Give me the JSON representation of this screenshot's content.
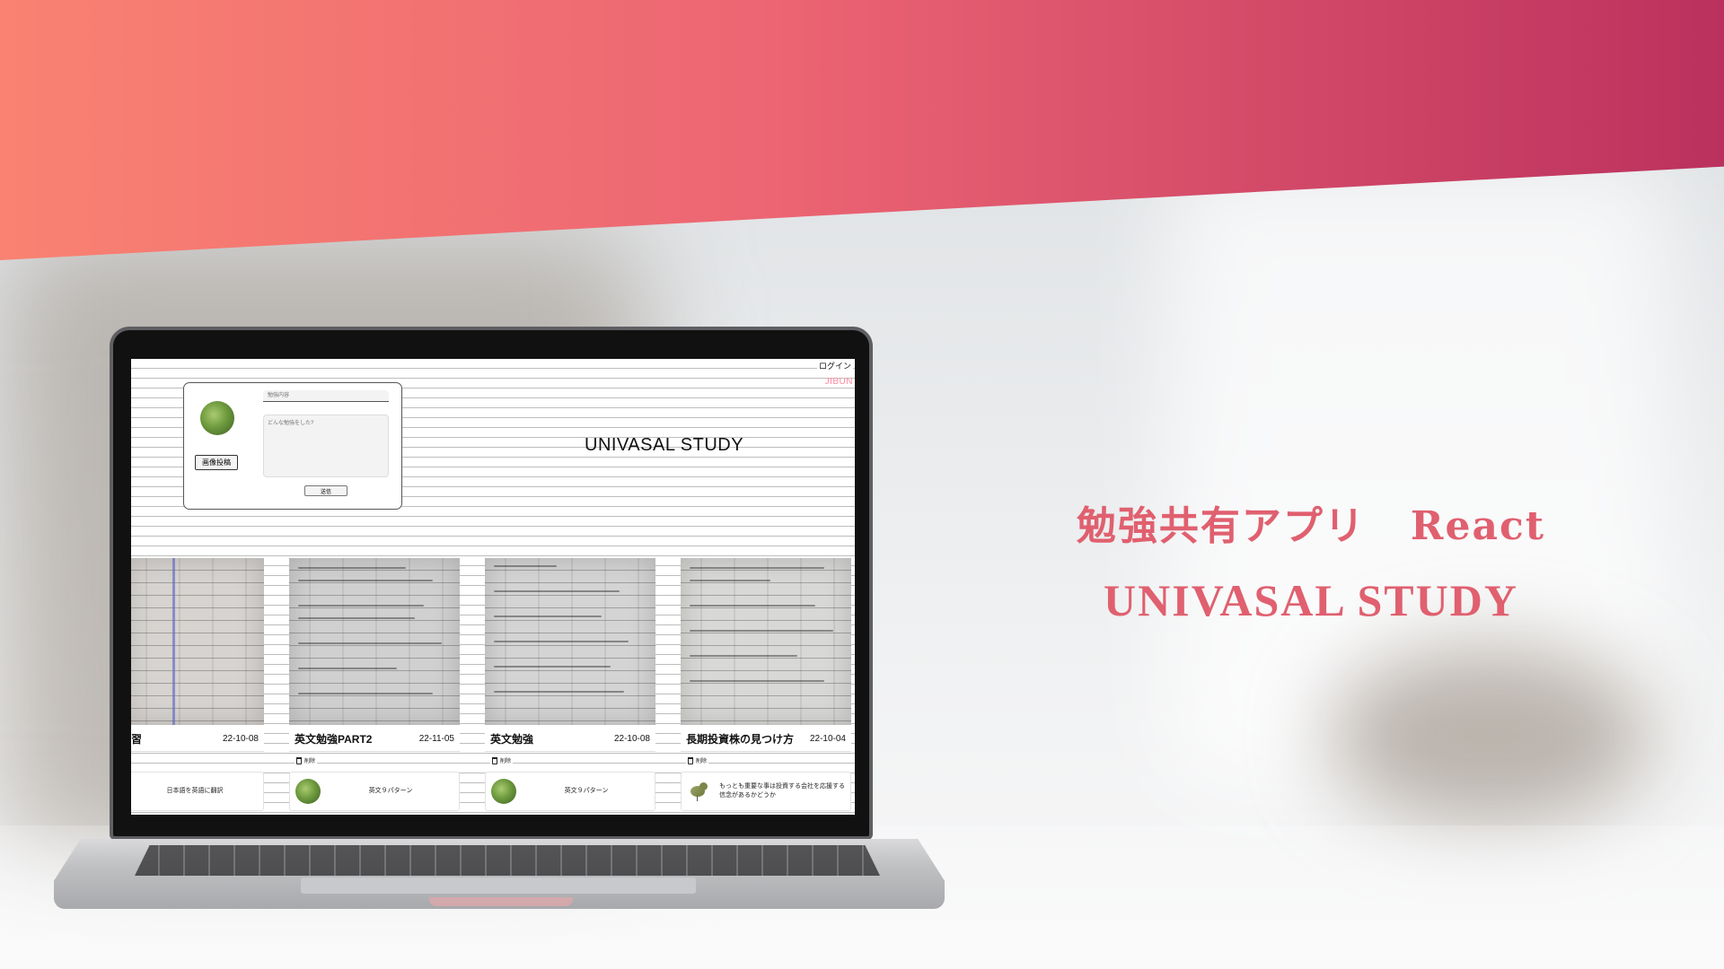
{
  "caption": {
    "line1_jp": "勉強共有アプリ",
    "line1_tech": "React",
    "line2": "UNIVASAL STUDY"
  },
  "colors": {
    "banner_start": "#f98272",
    "banner_end": "#bb315e",
    "caption_text": "#e0606f",
    "jibun_text": "#ff8aa1"
  },
  "app": {
    "login_label": "ログイン",
    "brand": "JIBUN",
    "title": "UNIVASAL STUDY",
    "form": {
      "image_button_label": "画像投稿",
      "title_placeholder": "勉強内容",
      "body_placeholder": "どんな勉強をした?",
      "submit_label": "送信"
    },
    "delete_label": "削除",
    "cards": [
      {
        "title": "習",
        "date": "22-10-08",
        "footer_text": "日本語を英語に翻訳",
        "avatar": "none",
        "show_delete": false
      },
      {
        "title": "英文勉強PART2",
        "date": "22-11-05",
        "footer_text": "英文９パターン",
        "avatar": "leaf-avatar",
        "show_delete": true
      },
      {
        "title": "英文勉強",
        "date": "22-10-08",
        "footer_text": "英文９パターン",
        "avatar": "leaf-avatar",
        "show_delete": true
      },
      {
        "title": "長期投資株の見つけ方",
        "date": "22-10-04",
        "footer_text": "もっとも重要な事は投資する会社を応援する信念があるかどうか",
        "avatar": "bird-avatar",
        "show_delete": true
      }
    ]
  }
}
